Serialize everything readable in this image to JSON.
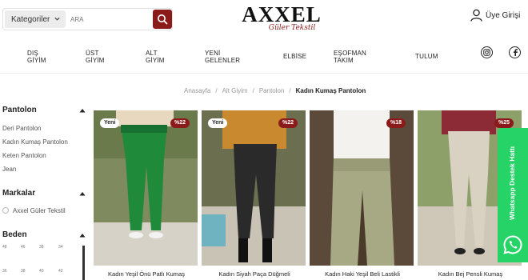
{
  "header": {
    "category_label": "Kategoriler",
    "search_placeholder": "ARA",
    "logo_main": "AXXEL",
    "logo_sub": "Güler Tekstil",
    "login_label": "Üye Girişi"
  },
  "nav": {
    "items": [
      {
        "label": "DIŞ GİYİM"
      },
      {
        "label": "ÜST GİYİM"
      },
      {
        "label": "ALT GİYİM"
      },
      {
        "label": "YENİ GELENLER"
      },
      {
        "label": "ELBİSE"
      },
      {
        "label": "EŞOFMAN TAKIM"
      },
      {
        "label": "TULUM"
      }
    ],
    "social": [
      "instagram-icon",
      "facebook-icon"
    ]
  },
  "breadcrumb": {
    "items": [
      "Anasayfa",
      "Alt Giyim",
      "Pantolon"
    ],
    "current": "Kadın Kumaş Pantolon"
  },
  "sidebar": {
    "pantolon_title": "Pantolon",
    "pantolon_links": [
      "Deri Pantolon",
      "Kadın Kumaş Pantolon",
      "Keten Pantolon",
      "Jean"
    ],
    "markalar_title": "Markalar",
    "brand": "Axxel Güler Tekstil",
    "beden_title": "Beden",
    "sizes": [
      "48",
      "46",
      "38",
      "34",
      "36",
      "38",
      "40",
      "42"
    ]
  },
  "products": [
    {
      "name": "Kadın Yeşil Önü Patlı Kumaş",
      "badge_new": "Yeni",
      "discount": "%22",
      "color": "#1f8a3a"
    },
    {
      "name": "Kadın Siyah Paça Düğmeli",
      "badge_new": "Yeni",
      "discount": "%22",
      "color": "#2b2a2a"
    },
    {
      "name": "Kadın Haki Yeşil Beli Lastikli",
      "badge_new": "",
      "discount": "%18",
      "color": "#a7a985"
    },
    {
      "name": "Kadın Bej Pensli Kumaş",
      "badge_new": "",
      "discount": "%25",
      "color": "#d9d2c3"
    }
  ],
  "whatsapp": {
    "label": "Whatsapp Destek Hattı",
    "color": "#25d366"
  },
  "colors": {
    "accent": "#8b1a1a"
  }
}
